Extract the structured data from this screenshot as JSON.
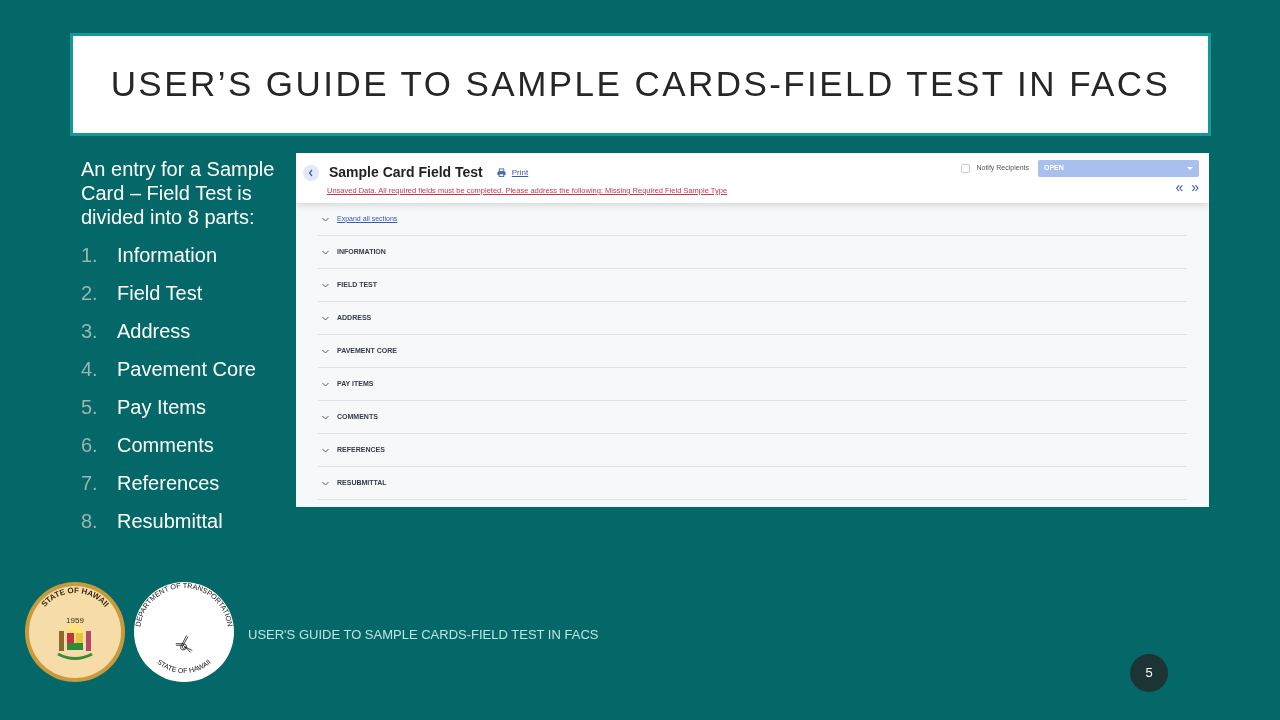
{
  "slide": {
    "title": "USER’S GUIDE TO SAMPLE CARDS-FIELD TEST IN FACS",
    "intro": "An entry for a Sample Card – Field Test is divided into 8 parts:",
    "parts": [
      {
        "number": "1.",
        "label": "Information"
      },
      {
        "number": "2.",
        "label": "Field Test"
      },
      {
        "number": "3.",
        "label": "Address"
      },
      {
        "number": "4.",
        "label": "Pavement Core"
      },
      {
        "number": "5.",
        "label": "Pay Items"
      },
      {
        "number": "6.",
        "label": "Comments"
      },
      {
        "number": "7.",
        "label": "References"
      },
      {
        "number": "8.",
        "label": "Resubmittal"
      }
    ],
    "seals": [
      {
        "kind": "state",
        "top_text": "STATE OF HAWAII",
        "year": "1959"
      },
      {
        "kind": "transport",
        "top_text": "DEPARTMENT OF TRANSPORTATION",
        "bottom_text": "STATE OF HAWAII"
      }
    ],
    "footer": "USER'S GUIDE TO SAMPLE CARDS-FIELD TEST IN FACS",
    "page_number": "5"
  },
  "app": {
    "title": "Sample Card Field Test",
    "print_link": "Print",
    "error": "Unsaved Data. All required fields must be completed. Please address the following: Missing Required Field Sample Type",
    "notify": {
      "label": "Notify Recipients",
      "checked": false
    },
    "status": {
      "value": "OPEN"
    },
    "nav": [
      "«",
      "»"
    ],
    "expand_link": "Expand all sections",
    "sections": [
      {
        "label": "INFORMATION",
        "expanded": false
      },
      {
        "label": "FIELD TEST",
        "expanded": false
      },
      {
        "label": "ADDRESS",
        "expanded": false
      },
      {
        "label": "PAVEMENT CORE",
        "expanded": false
      },
      {
        "label": "PAY ITEMS",
        "expanded": false
      },
      {
        "label": "COMMENTS",
        "expanded": false
      },
      {
        "label": "REFERENCES",
        "expanded": false
      },
      {
        "label": "RESUBMITTAL",
        "expanded": false
      }
    ]
  }
}
